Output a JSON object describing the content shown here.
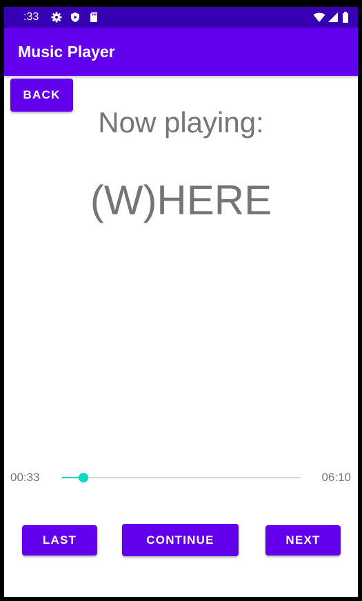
{
  "status_bar": {
    "time": ":33",
    "icons": [
      "gear-icon",
      "shield-icon",
      "sd-card-icon",
      "wifi-icon",
      "signal-icon",
      "battery-icon"
    ]
  },
  "app_bar": {
    "title": "Music Player"
  },
  "buttons": {
    "back": "BACK",
    "last": "LAST",
    "continue": "CONTINUE",
    "next": "NEXT"
  },
  "player": {
    "now_playing_label": "Now playing:",
    "song_title": "(W)HERE",
    "current_time": "00:33",
    "total_time": "06:10",
    "progress_fraction": 0.09
  },
  "colors": {
    "primary": "#6200EE",
    "primary_dark": "#3700B3",
    "accent": "#03DAC5",
    "text_secondary": "#757575"
  }
}
